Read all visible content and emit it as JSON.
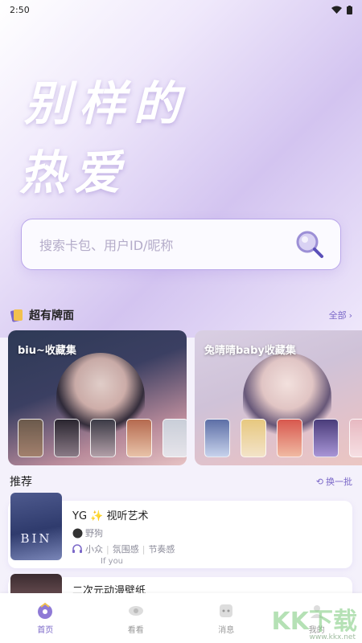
{
  "status": {
    "time": "2:50"
  },
  "hero": {
    "slogan_line1": "别样的",
    "slogan_line2": "热爱"
  },
  "search": {
    "placeholder": "搜索卡包、用户ID/昵称"
  },
  "collections": {
    "title": "超有牌面",
    "more_label": "全部",
    "cards": [
      {
        "title": "biu~收藏集"
      },
      {
        "title": "兔晴晴baby收藏集"
      }
    ]
  },
  "recommend": {
    "title": "推荐",
    "refresh_label": "换一批",
    "items": [
      {
        "cover_text": "BIN",
        "title": "YG ✨ 视听艺术",
        "author": "野狗",
        "tags": [
          "小众",
          "氛围感",
          "节奏感"
        ],
        "song": "If you"
      },
      {
        "title": "二次元动漫壁纸"
      }
    ]
  },
  "tabs": [
    {
      "label": "首页",
      "active": true
    },
    {
      "label": "看看",
      "active": false
    },
    {
      "label": "消息",
      "active": false
    },
    {
      "label": "我的",
      "active": false
    }
  ],
  "watermark": {
    "main": "KK下载",
    "sub": "www.kkx.net"
  },
  "colors": {
    "accent": "#7b68c8",
    "search_border": "#b9a6ea"
  }
}
